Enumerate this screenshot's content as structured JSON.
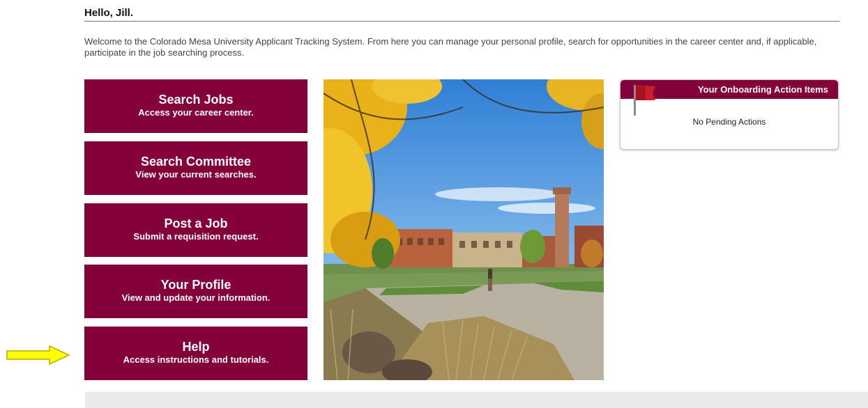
{
  "header": {
    "greeting": "Hello, Jill."
  },
  "welcome_text": "Welcome to the Colorado Mesa University Applicant Tracking System. From here you can manage your personal profile, search for opportunities in the career center and, if applicable, participate in the job searching process.",
  "tiles": [
    {
      "title": "Search Jobs",
      "subtitle": "Access your career center."
    },
    {
      "title": "Search Committee",
      "subtitle": "View your current searches."
    },
    {
      "title": "Post a Job",
      "subtitle": "Submit a requisition request."
    },
    {
      "title": "Your Profile",
      "subtitle": "View and update your information."
    },
    {
      "title": "Help",
      "subtitle": "Access instructions and tutorials."
    }
  ],
  "onboarding": {
    "title": "Your Onboarding Action Items",
    "message": "No Pending Actions",
    "icon": "flag-icon"
  },
  "annotation": {
    "icon": "arrow-right-icon",
    "color": "#ffff00"
  },
  "colors": {
    "brand": "#84003a",
    "footer": "#e9e9e9"
  }
}
